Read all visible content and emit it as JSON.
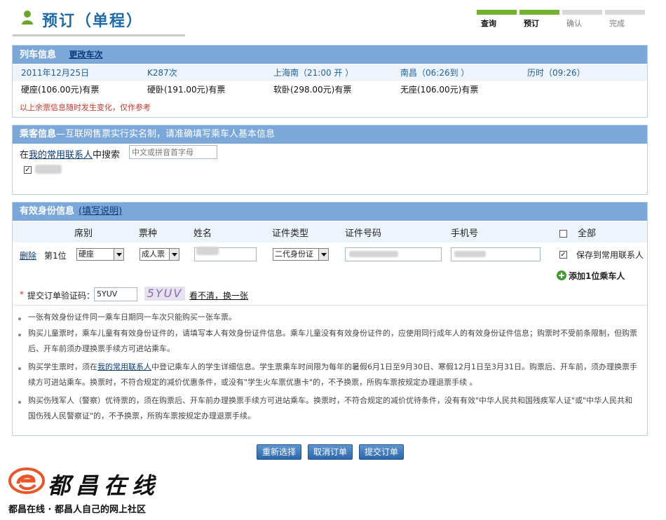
{
  "header": {
    "title": "预订（单程）",
    "steps": [
      {
        "label": "查询",
        "active": true
      },
      {
        "label": "预订",
        "active": true
      },
      {
        "label": "确认",
        "active": false
      },
      {
        "label": "完成",
        "active": false
      }
    ]
  },
  "train": {
    "heading": "列车信息",
    "change_link": "更改车次",
    "date": "2011年12月25日",
    "number": "K287次",
    "from": "上海南（21:00 开 ）",
    "to": "南昌（06:26到 ）",
    "duration": "历时（09:26）",
    "seats": [
      "硬座(106.00元)有票",
      "硬卧(191.00元)有票",
      "软卧(298.00元)有票",
      "无座(106.00元)有票"
    ],
    "note": "以上余票信息随时发生变化，仅作参考"
  },
  "passenger": {
    "heading": "乘客信息",
    "subheading": "—互联网售票实行实名制，请准确填写乘车人基本信息",
    "search_prefix": "在",
    "search_link": "我的常用联系人",
    "search_suffix": "中搜索",
    "search_placeholder": "中文或拼音首字母"
  },
  "identity": {
    "heading": "有效身份信息",
    "help_link": "(填写说明)",
    "columns": [
      "席别",
      "票种",
      "姓名",
      "证件类型",
      "证件号码",
      "手机号",
      "全部"
    ],
    "row": {
      "delete": "删除",
      "position": "第1位",
      "seat": "硬座",
      "ticket_type": "成人票",
      "id_type": "二代身份证",
      "save_label": "保存到常用联系人"
    },
    "add_passenger": "添加1位乘车人",
    "captcha_label": "提交订单验证码：",
    "captcha_required": "*",
    "captcha_value": "5YUV",
    "captcha_image_text": "5YUV",
    "captcha_refresh": "看不清，换一张"
  },
  "notes": [
    {
      "text": "一张有效身份证件同一乘车日期同一车次只能购买一张车票。"
    },
    {
      "text": "购买儿童票时，乘车儿童有有效身份证件的，请填写本人有效身份证件信息。乘车儿童没有有效身份证件的，应使用同行成年人的有效身份证件信息；购票时不受前条限制，但购票后、开车前须办理换票手续方可进站乘车。"
    },
    {
      "pre": "购买学生票时，须在",
      "link": "我的常用联系人",
      "post": "中登记乘车人的学生详细信息。学生票乘车时间限为每年的暑假6月1日至9月30日、寒假12月1日至3月31日。购票后、开车前，须办理换票手续方可进站乘车。换票时，不符合规定的减价优惠条件，或没有\"学生火车票优惠卡\"的，不予换票，所购车票按规定办理退票手续 。"
    },
    {
      "text": "购买伤残军人（警察）优待票的，须在购票后、开车前办理换票手续方可进站乘车。换票时，不符合规定的减价优待条件，没有有效\"中华人民共和国残疾军人证\"或\"中华人民共和国伤残人民警察证\"的，不予换票，所购车票按规定办理退票手续。"
    }
  ],
  "buttons": {
    "reselect": "重新选择",
    "cancel": "取消订单",
    "submit": "提交订单"
  },
  "watermark": {
    "brand": "都昌在线",
    "tagline": "都昌在线 · 都昌人自己的网上社区"
  },
  "colors": {
    "panel_header": "#7ba8d9",
    "step_active": "#71b22e",
    "title": "#1e6aa6",
    "button": "#2d67ac",
    "note_red": "#c0392b"
  }
}
